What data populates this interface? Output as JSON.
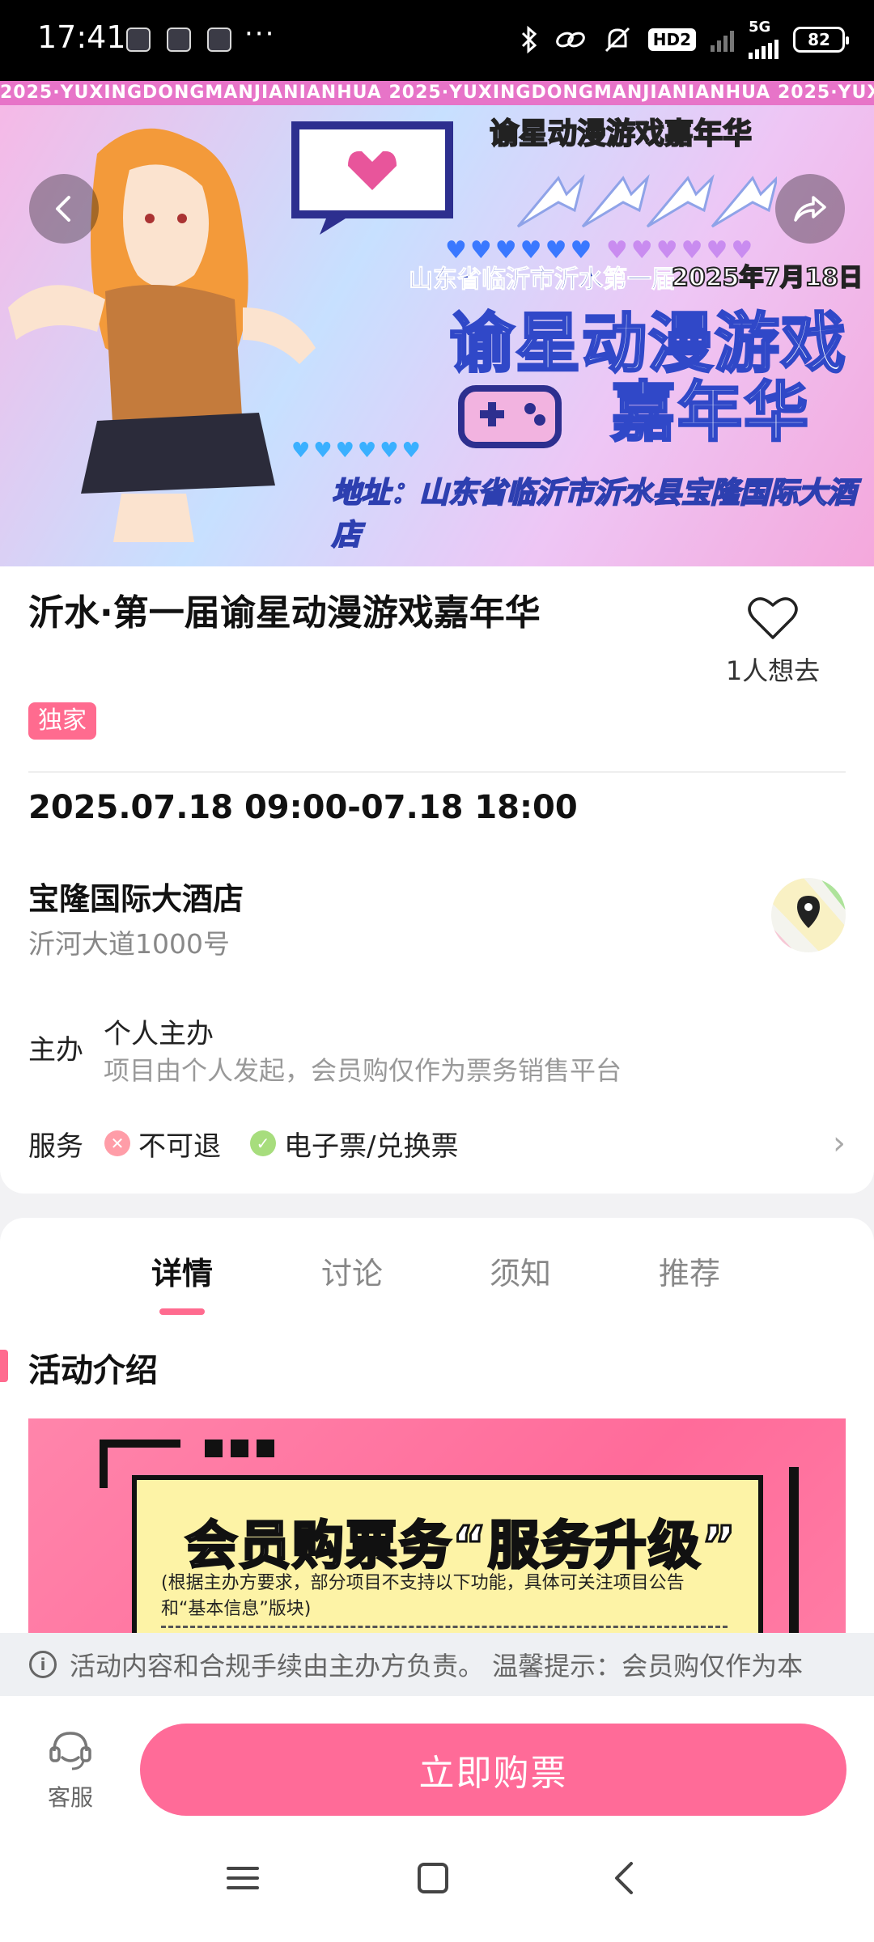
{
  "status_bar": {
    "time": "17:41",
    "more": "···",
    "network_badge": "HD2",
    "network_type": "5G",
    "battery": "82"
  },
  "banner": {
    "strip_text": "2025·YUXINGDONGMANJIANIANHUA   2025·YUXINGDONGMANJIANIANHUA   2025·YUXINGDONGMANJIANIANHUA   2025·YUXIN",
    "header_title": "谕星动漫游戏嘉年华",
    "subtitle": "山东省临沂市沂水第一届",
    "date": "2025年7月18日",
    "title_line1": "谕星动漫游戏",
    "title_line2": "嘉年华",
    "address": "地址：山东省临沂市沂水县宝隆国际大酒店"
  },
  "event": {
    "title": "沂水·第一届谕星动漫游戏嘉年华",
    "wishlist_text": "1人想去",
    "badge": "独家",
    "datetime": "2025.07.18 09:00-07.18 18:00",
    "venue": "宝隆国际大酒店",
    "address": "沂河大道1000号",
    "organizer_label": "主办",
    "organizer_name": "个人主办",
    "organizer_note": "项目由个人发起，会员购仅作为票务销售平台",
    "service_label": "服务",
    "services": [
      {
        "label": "不可退",
        "status": "no"
      },
      {
        "label": "电子票/兑换票",
        "status": "yes"
      }
    ]
  },
  "tabs": [
    "详情",
    "讨论",
    "须知",
    "推荐"
  ],
  "active_tab": "详情",
  "section_title": "活动介绍",
  "poster": {
    "headline": "会员购票务“服务升级”",
    "note": "(根据主办方要求，部分项目不支持以下功能，具体可关注项目公告和“基本信息”版块)"
  },
  "notice": "活动内容和合规手续由主办方负责。 温馨提示：会员购仅作为本",
  "bottom_bar": {
    "service_label": "客服",
    "buy_label": "立即购票"
  },
  "colors": {
    "accent": "#ff6b98",
    "badge": "#ff6b8f",
    "no_icon": "#ff9da8",
    "yes_icon": "#a7dd7d"
  }
}
